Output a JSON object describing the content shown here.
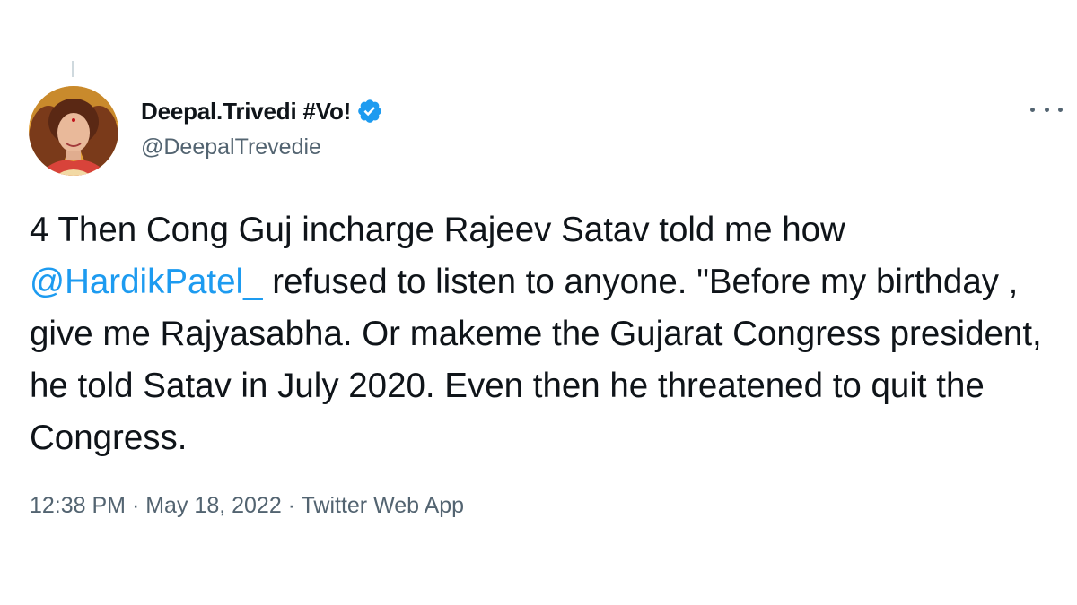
{
  "author": {
    "display_name": "Deepal.Trivedi #Vo!",
    "handle": "@DeepalTrevedie",
    "verified": true,
    "avatar_icon": "profile-photo"
  },
  "tweet": {
    "text_before_mention": "4 Then Cong Guj incharge Rajeev Satav told me how ",
    "mention": "@HardikPatel_",
    "text_after_mention": " refused to listen to anyone. \"Before my birthday , give me Rajyasabha. Or makeme the Gujarat Congress president, he told Satav in July 2020. Even then he threatened to quit the Congress."
  },
  "meta": {
    "time": "12:38 PM",
    "separator": " · ",
    "date": "May 18, 2022",
    "source": "Twitter Web App"
  },
  "colors": {
    "link": "#1d9bf0",
    "secondary_text": "#536471",
    "primary_text": "#0f1419",
    "verified_badge": "#1d9bf0"
  },
  "icons": {
    "more": "more-horizontal-icon",
    "verified": "verified-badge-icon"
  }
}
